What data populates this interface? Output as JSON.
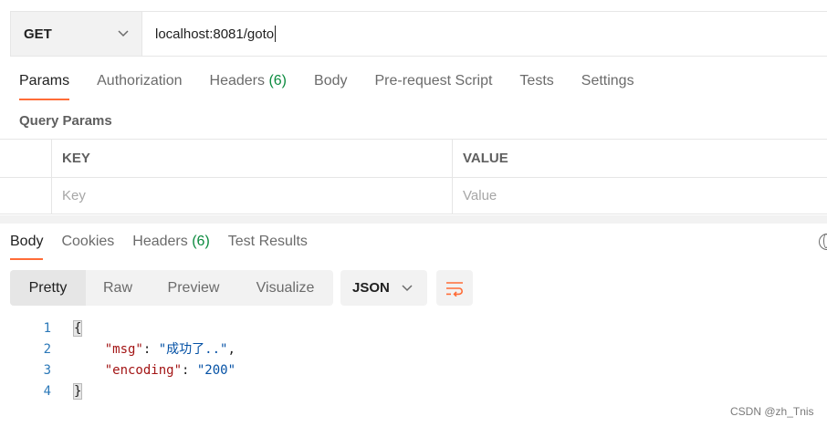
{
  "request": {
    "method": "GET",
    "url": "localhost:8081/goto"
  },
  "request_tabs": [
    {
      "label": "Params",
      "count": ""
    },
    {
      "label": "Authorization",
      "count": ""
    },
    {
      "label": "Headers",
      "count": "(6)"
    },
    {
      "label": "Body",
      "count": ""
    },
    {
      "label": "Pre-request Script",
      "count": ""
    },
    {
      "label": "Tests",
      "count": ""
    },
    {
      "label": "Settings",
      "count": ""
    }
  ],
  "query_params": {
    "title": "Query Params",
    "columns": [
      "KEY",
      "VALUE"
    ],
    "placeholders": {
      "key": "Key",
      "value": "Value"
    }
  },
  "response_tabs": [
    {
      "label": "Body",
      "count": ""
    },
    {
      "label": "Cookies",
      "count": ""
    },
    {
      "label": "Headers",
      "count": "(6)"
    },
    {
      "label": "Test Results",
      "count": ""
    }
  ],
  "view_modes": [
    "Pretty",
    "Raw",
    "Preview",
    "Visualize"
  ],
  "format": "JSON",
  "code_lines": [
    {
      "num": "1",
      "open": "{"
    },
    {
      "num": "2",
      "key": "\"msg\"",
      "sep": ": ",
      "value": "\"成功了..\"",
      "tail": ","
    },
    {
      "num": "3",
      "key": "\"encoding\"",
      "sep": ": ",
      "value": "\"200\"",
      "tail": ""
    },
    {
      "num": "4",
      "close": "}"
    }
  ],
  "watermark": "CSDN @zh_Tnis",
  "colors": {
    "accent": "#ff6c37",
    "count_green": "#0b8a3e",
    "json_key": "#a31515",
    "json_string": "#0451a5",
    "line_number": "#2b78b8"
  }
}
